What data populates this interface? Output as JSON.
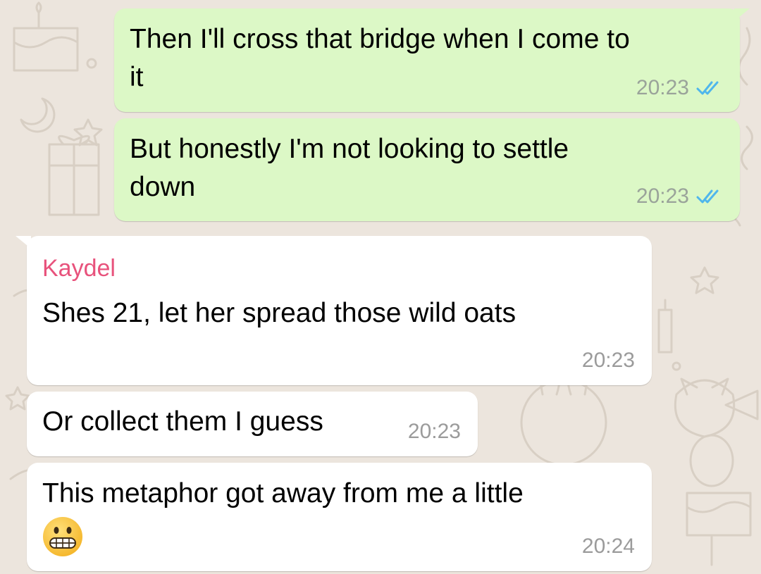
{
  "conversation": {
    "messages": [
      {
        "direction": "outgoing",
        "lines": [
          "Then I'll cross that bridge when I come to",
          "it"
        ],
        "time": "20:23",
        "status_icon": "double-check-read-icon"
      },
      {
        "direction": "outgoing",
        "lines": [
          "But honestly I'm not looking to settle",
          "down"
        ],
        "time": "20:23",
        "status_icon": "double-check-read-icon"
      },
      {
        "direction": "incoming",
        "sender": "Kaydel",
        "lines": [
          "Shes 21, let her spread those wild oats"
        ],
        "time": "20:23"
      },
      {
        "direction": "incoming",
        "lines": [
          "Or collect them I guess"
        ],
        "time": "20:23"
      },
      {
        "direction": "incoming",
        "lines": [
          "This metaphor got away from me a little"
        ],
        "emoji": "grimacing-face-emoji",
        "time": "20:24"
      }
    ]
  },
  "colors": {
    "chat_background": "#ece5dd",
    "outgoing_bubble": "#dcf8c6",
    "incoming_bubble": "#ffffff",
    "sender_name": "#e8527c",
    "read_ticks": "#4fb6ec"
  }
}
